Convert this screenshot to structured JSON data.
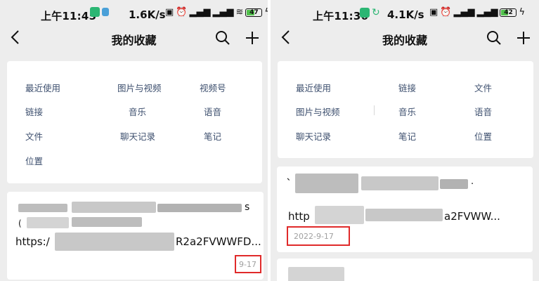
{
  "left": {
    "status": {
      "time": "上午11:45",
      "speed": "1.6K/s",
      "battery": "47",
      "battery_fill": 0.47
    },
    "title": "我的收藏",
    "menu": [
      {
        "label": "最近使用"
      },
      {
        "label": "图片与视频"
      },
      {
        "label": "视频号"
      },
      {
        "label": "链接"
      },
      {
        "label": "音乐"
      },
      {
        "label": "语音"
      },
      {
        "label": "文件"
      },
      {
        "label": "聊天记录"
      },
      {
        "label": "笔记"
      },
      {
        "label": "位置"
      }
    ],
    "card": {
      "link_start": "https:/",
      "link_end": "R2a2FVWWFD...",
      "date": "9-17",
      "mark_left": "s",
      "mark_small": "("
    }
  },
  "right": {
    "status": {
      "time": "上午11:36",
      "speed": "4.1K/s",
      "battery": "42",
      "battery_fill": 0.42
    },
    "title": "我的收藏",
    "menu": [
      {
        "label": "最近使用"
      },
      {
        "label": "链接"
      },
      {
        "label": "文件"
      },
      {
        "label": "图片与视频"
      },
      {
        "label": "音乐"
      },
      {
        "label": "语音"
      },
      {
        "label": "聊天记录"
      },
      {
        "label": "笔记"
      },
      {
        "label": "位置"
      }
    ],
    "card": {
      "link_start": "http",
      "link_end": "a2FVWW...",
      "date": "2022-9-17",
      "mark_top": "、",
      "mark_dot": "."
    }
  },
  "colors": {
    "accent_text": "#3d4f6e",
    "highlight": "#e02a2a",
    "bg": "#ededed",
    "battery": "#51c14b"
  }
}
